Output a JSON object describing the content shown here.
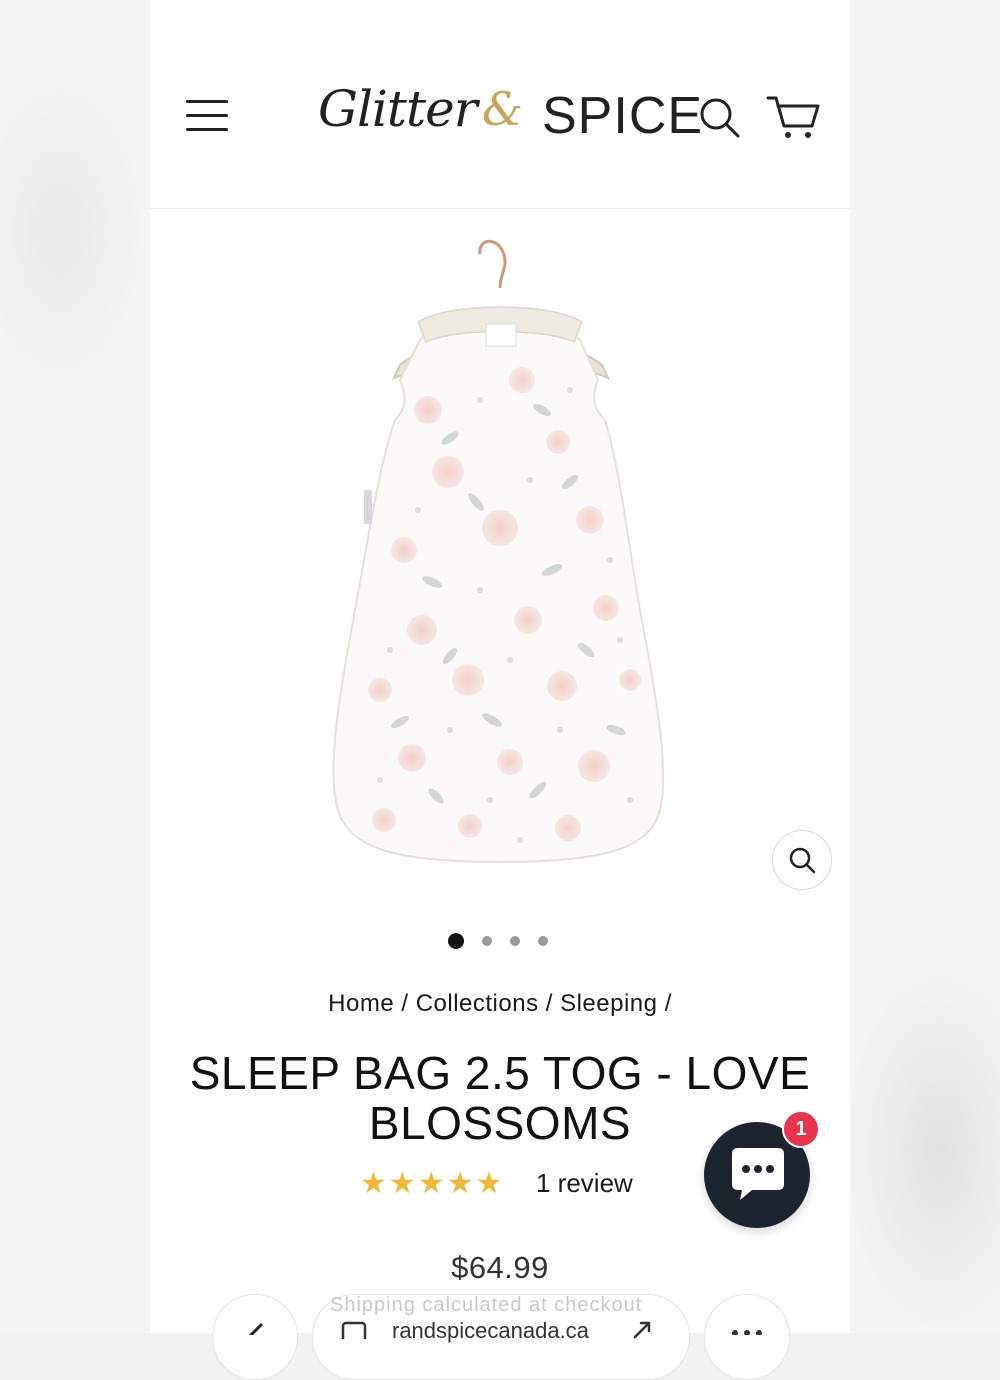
{
  "header": {
    "logo_script": "Glitter",
    "logo_amp": "&",
    "logo_word": "SPICE"
  },
  "icons": {
    "menu": "hamburger-icon",
    "search": "search-icon",
    "cart": "cart-icon",
    "zoom": "zoom-icon",
    "chat": "chat-icon"
  },
  "gallery": {
    "slide_count": 4,
    "active_index": 0
  },
  "breadcrumb": {
    "home": "Home",
    "collections": "Collections",
    "sleeping": "Sleeping",
    "separator": "/"
  },
  "product": {
    "title": "SLEEP BAG 2.5 TOG - LOVE BLOSSOMS",
    "rating_stars": "★★★★★",
    "rating_value": 5,
    "review_text": "1 review",
    "price": "$64.99"
  },
  "chat": {
    "badge_count": "1"
  },
  "browser": {
    "faded_text": "Shipping calculated at checkout",
    "url": "randspicecanada.ca"
  },
  "colors": {
    "star": "#f0b93a",
    "logo_gold": "#c9a45a",
    "chat_bg": "#1c2430",
    "badge": "#e8344e"
  }
}
